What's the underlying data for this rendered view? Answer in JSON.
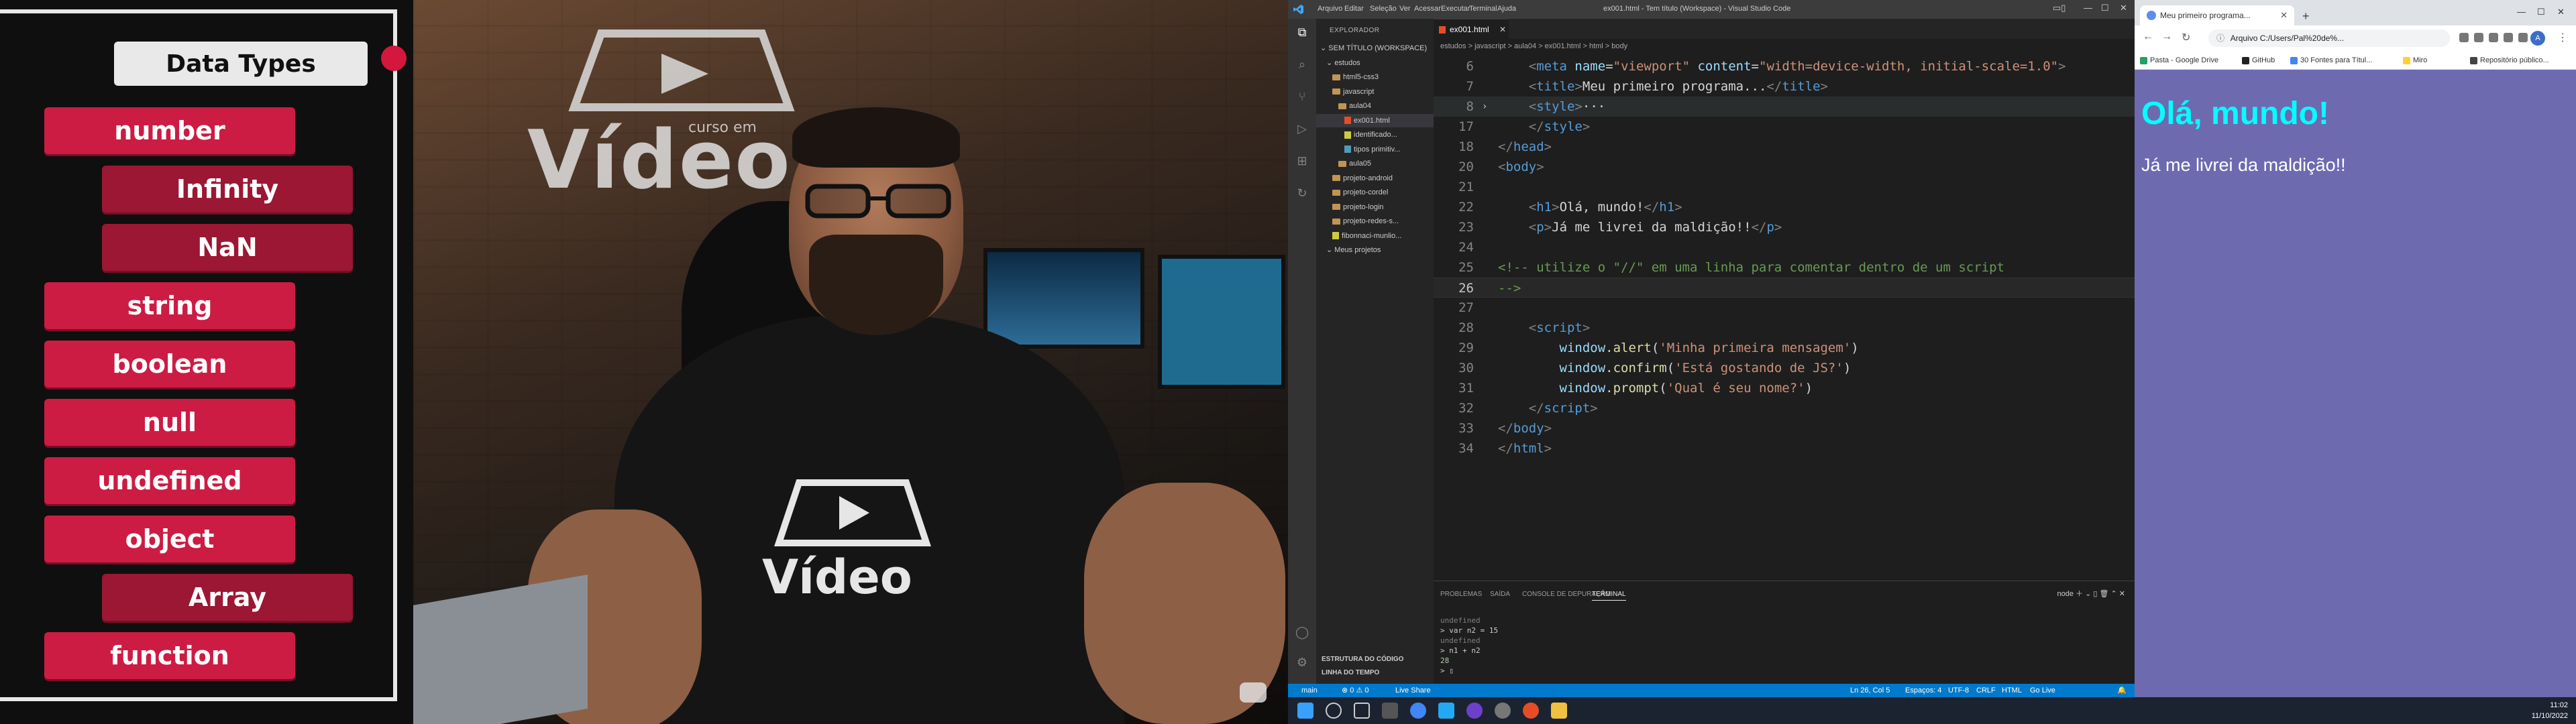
{
  "left_panel": {
    "title": "Data Types",
    "types": [
      {
        "label": "number",
        "level": 0
      },
      {
        "label": "Infinity",
        "level": 1
      },
      {
        "label": "NaN",
        "level": 1
      },
      {
        "label": "string",
        "level": 0
      },
      {
        "label": "boolean",
        "level": 0
      },
      {
        "label": "null",
        "level": 0
      },
      {
        "label": "undefined",
        "level": 0
      },
      {
        "label": "object",
        "level": 0
      },
      {
        "label": "Array",
        "level": 1
      },
      {
        "label": "function",
        "level": 0
      }
    ]
  },
  "video": {
    "wall_logo_main": "Vídeo",
    "wall_logo_small": "curso em",
    "shirt_text": "Vídeo"
  },
  "vscode": {
    "menu": [
      "Arquivo",
      "Editar",
      "Seleção",
      "Ver",
      "Acessar",
      "Executar",
      "Terminal",
      "Ajuda"
    ],
    "window_title": "ex001.html - Tem título (Workspace) - Visual Studio Code",
    "explorer_header": "EXPLORADOR",
    "tree": [
      {
        "label": "SEM TÍTULO (WORKSPACE)",
        "indent": 0,
        "icon": "none"
      },
      {
        "label": "estudos",
        "indent": 1,
        "icon": "none"
      },
      {
        "label": "html5-css3",
        "indent": 2,
        "icon": "folder"
      },
      {
        "label": "javascript",
        "indent": 2,
        "icon": "folder"
      },
      {
        "label": "aula04",
        "indent": 3,
        "icon": "folder"
      },
      {
        "label": "ex001.html",
        "indent": 4,
        "icon": "html",
        "active": true
      },
      {
        "label": "identificado...",
        "indent": 4,
        "icon": "js"
      },
      {
        "label": "tipos primitiv...",
        "indent": 4,
        "icon": "md"
      },
      {
        "label": "aula05",
        "indent": 3,
        "icon": "folder"
      },
      {
        "label": "projeto-android",
        "indent": 2,
        "icon": "folder"
      },
      {
        "label": "projeto-cordel",
        "indent": 2,
        "icon": "folder"
      },
      {
        "label": "projeto-login",
        "indent": 2,
        "icon": "folder"
      },
      {
        "label": "projeto-redes-s...",
        "indent": 2,
        "icon": "folder"
      },
      {
        "label": "fibonnaci-munlio...",
        "indent": 2,
        "icon": "js"
      },
      {
        "label": "Meus projetos",
        "indent": 1,
        "icon": "none"
      }
    ],
    "outline_label": "ESTRUTURA DO CÓDIGO",
    "timeline_label": "LINHA DO TEMPO",
    "tab_label": "ex001.html",
    "breadcrumb": "estudos > javascript > aula04 > ex001.html > html > body",
    "code_lines": [
      {
        "n": "6",
        "tokens": [
          [
            "    ",
            "t-text"
          ],
          [
            "<",
            "t-punc"
          ],
          [
            "meta",
            "t-tag"
          ],
          [
            " name",
            "t-attr"
          ],
          [
            "=",
            "t-text"
          ],
          [
            "\"viewport\"",
            "t-str"
          ],
          [
            " content",
            "t-attr"
          ],
          [
            "=",
            "t-text"
          ],
          [
            "\"width=device-width, initial-scale=1.0\"",
            "t-str"
          ],
          [
            ">",
            "t-punc"
          ]
        ]
      },
      {
        "n": "7",
        "tokens": [
          [
            "    ",
            "t-text"
          ],
          [
            "<",
            "t-punc"
          ],
          [
            "title",
            "t-tag"
          ],
          [
            ">",
            "t-punc"
          ],
          [
            "Meu primeiro programa...",
            "t-text"
          ],
          [
            "</",
            "t-punc"
          ],
          [
            "title",
            "t-tag"
          ],
          [
            ">",
            "t-punc"
          ]
        ]
      },
      {
        "n": "8",
        "fold": true,
        "current": false,
        "highlight": true,
        "tokens": [
          [
            "    ",
            "t-text"
          ],
          [
            "<",
            "t-punc"
          ],
          [
            "style",
            "t-tag"
          ],
          [
            ">",
            "t-punc"
          ],
          [
            "···",
            "t-text"
          ]
        ]
      },
      {
        "n": "17",
        "tokens": [
          [
            "    ",
            "t-text"
          ],
          [
            "</",
            "t-punc"
          ],
          [
            "style",
            "t-tag"
          ],
          [
            ">",
            "t-punc"
          ]
        ]
      },
      {
        "n": "18",
        "tokens": [
          [
            "",
            "t-text"
          ],
          [
            "</",
            "t-punc"
          ],
          [
            "head",
            "t-tag"
          ],
          [
            ">",
            "t-punc"
          ]
        ]
      },
      {
        "n": "20",
        "tokens": [
          [
            "",
            "t-text"
          ],
          [
            "<",
            "t-punc"
          ],
          [
            "body",
            "t-tag"
          ],
          [
            ">",
            "t-punc"
          ]
        ]
      },
      {
        "n": "21",
        "tokens": []
      },
      {
        "n": "22",
        "tokens": [
          [
            "    ",
            "t-text"
          ],
          [
            "<",
            "t-punc"
          ],
          [
            "h1",
            "t-tag"
          ],
          [
            ">",
            "t-punc"
          ],
          [
            "Olá, mundo!",
            "t-text"
          ],
          [
            "</",
            "t-punc"
          ],
          [
            "h1",
            "t-tag"
          ],
          [
            ">",
            "t-punc"
          ]
        ]
      },
      {
        "n": "23",
        "tokens": [
          [
            "    ",
            "t-text"
          ],
          [
            "<",
            "t-punc"
          ],
          [
            "p",
            "t-tag"
          ],
          [
            ">",
            "t-punc"
          ],
          [
            "Já me livrei da maldição!!",
            "t-text"
          ],
          [
            "</",
            "t-punc"
          ],
          [
            "p",
            "t-tag"
          ],
          [
            ">",
            "t-punc"
          ]
        ]
      },
      {
        "n": "24",
        "tokens": []
      },
      {
        "n": "25",
        "tokens": [
          [
            "<!-- utilize o \"//\" em uma linha para comentar dentro de um script",
            "t-com"
          ]
        ]
      },
      {
        "n": "26",
        "current": true,
        "tokens": [
          [
            "-->",
            "t-com"
          ]
        ]
      },
      {
        "n": "27",
        "tokens": []
      },
      {
        "n": "28",
        "tokens": [
          [
            "    ",
            "t-text"
          ],
          [
            "<",
            "t-punc"
          ],
          [
            "script",
            "t-tag"
          ],
          [
            ">",
            "t-punc"
          ]
        ]
      },
      {
        "n": "29",
        "tokens": [
          [
            "        ",
            "t-text"
          ],
          [
            "window",
            "t-obj"
          ],
          [
            ".",
            "t-text"
          ],
          [
            "alert",
            "t-fn"
          ],
          [
            "(",
            "t-text"
          ],
          [
            "'Minha primeira mensagem'",
            "t-str"
          ],
          [
            ")",
            "t-text"
          ]
        ]
      },
      {
        "n": "30",
        "tokens": [
          [
            "        ",
            "t-text"
          ],
          [
            "window",
            "t-obj"
          ],
          [
            ".",
            "t-text"
          ],
          [
            "confirm",
            "t-fn"
          ],
          [
            "(",
            "t-text"
          ],
          [
            "'Está gostando de JS?'",
            "t-str"
          ],
          [
            ")",
            "t-text"
          ]
        ]
      },
      {
        "n": "31",
        "tokens": [
          [
            "        ",
            "t-text"
          ],
          [
            "window",
            "t-obj"
          ],
          [
            ".",
            "t-text"
          ],
          [
            "prompt",
            "t-fn"
          ],
          [
            "(",
            "t-text"
          ],
          [
            "'Qual é seu nome?'",
            "t-str"
          ],
          [
            ")",
            "t-text"
          ]
        ]
      },
      {
        "n": "32",
        "tokens": [
          [
            "    ",
            "t-text"
          ],
          [
            "</",
            "t-punc"
          ],
          [
            "script",
            "t-tag"
          ],
          [
            ">",
            "t-punc"
          ]
        ]
      },
      {
        "n": "33",
        "tokens": [
          [
            "",
            "t-text"
          ],
          [
            "</",
            "t-punc"
          ],
          [
            "body",
            "t-tag"
          ],
          [
            ">",
            "t-punc"
          ]
        ]
      },
      {
        "n": "34",
        "tokens": [
          [
            "",
            "t-text"
          ],
          [
            "</",
            "t-punc"
          ],
          [
            "html",
            "t-tag"
          ],
          [
            ">",
            "t-punc"
          ]
        ]
      }
    ],
    "panel_tabs": [
      "PROBLEMAS",
      "SAÍDA",
      "CONSOLE DE DEPURAÇÃO",
      "TERMINAL"
    ],
    "panel_active_tab": "TERMINAL",
    "panel_tools": "node",
    "terminal": [
      {
        "text": "undefined",
        "style": "dim"
      },
      {
        "text": "> var n2 = 15",
        "style": ""
      },
      {
        "text": "undefined",
        "style": "dim"
      },
      {
        "text": "> n1 + n2",
        "style": ""
      },
      {
        "text": "28",
        "style": "num"
      },
      {
        "text": "> ▯",
        "style": ""
      }
    ],
    "status_left": [
      "main",
      "⊗ 0 ⚠ 0",
      "Live Share"
    ],
    "status_right": [
      "Ln 26, Col 5",
      "Espaços: 4",
      "UTF-8",
      "CRLF",
      "HTML",
      "Go Live"
    ]
  },
  "browser": {
    "tab_title": "Meu primeiro programa...",
    "address": "Arquivo   C:/Users/Pal%20de%...",
    "bookmarks": [
      {
        "label": "Pasta - Google Drive",
        "color": "#1fa463"
      },
      {
        "label": "GitHub",
        "color": "#222222"
      },
      {
        "label": "30 Fontes para Títul...",
        "color": "#4285f4"
      },
      {
        "label": "Miro",
        "color": "#ffd02f"
      },
      {
        "label": "Repositório público...",
        "color": "#444444"
      }
    ],
    "avatar_letter": "A",
    "page_h1": "Olá, mundo!",
    "page_p": "Já me livrei da maldição!!"
  },
  "taskbar": {
    "time": "11:02",
    "date": "11/10/2022"
  },
  "colors": {
    "pill": "#cc1c43",
    "pill_sub": "#9b1733",
    "vscode_status": "#007acc",
    "page_bg": "#6e6ab0",
    "page_h1": "#00ffff"
  }
}
